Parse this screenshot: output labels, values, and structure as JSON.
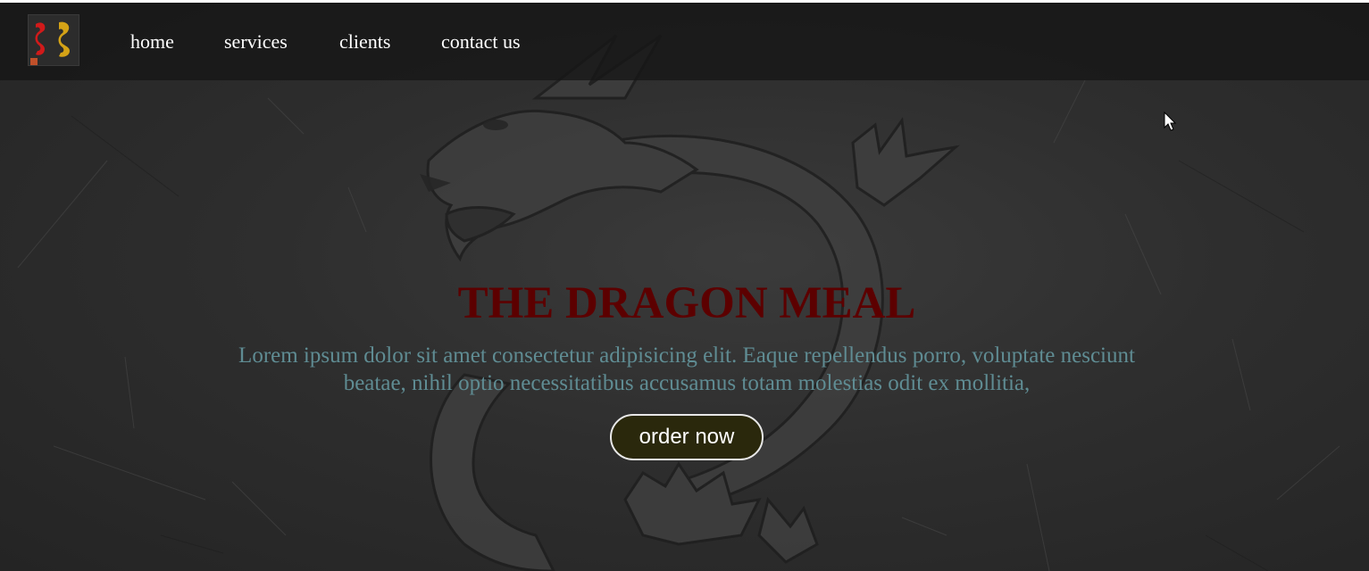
{
  "colors": {
    "background": "#2e2e2e",
    "navbar": "#161616",
    "title": "#5c0000",
    "body_text": "#5f8c93",
    "button_bg": "#2a280c",
    "button_border": "#e8e8e8",
    "nav_text": "#ffffff"
  },
  "header": {
    "logo_icon": "dragon-logo-icon",
    "nav": {
      "home": "home",
      "services": "services",
      "clients": "clients",
      "contact": "contact us"
    }
  },
  "hero": {
    "background_icon": "dragon-emblem-icon",
    "title": "THE DRAGON MEAL",
    "description": "Lorem ipsum dolor sit amet consectetur adipisicing elit. Eaque repellendus porro, voluptate nesciunt beatae, nihil optio necessitatibus accusamus totam molestias odit ex mollitia,",
    "cta_label": "order now"
  }
}
